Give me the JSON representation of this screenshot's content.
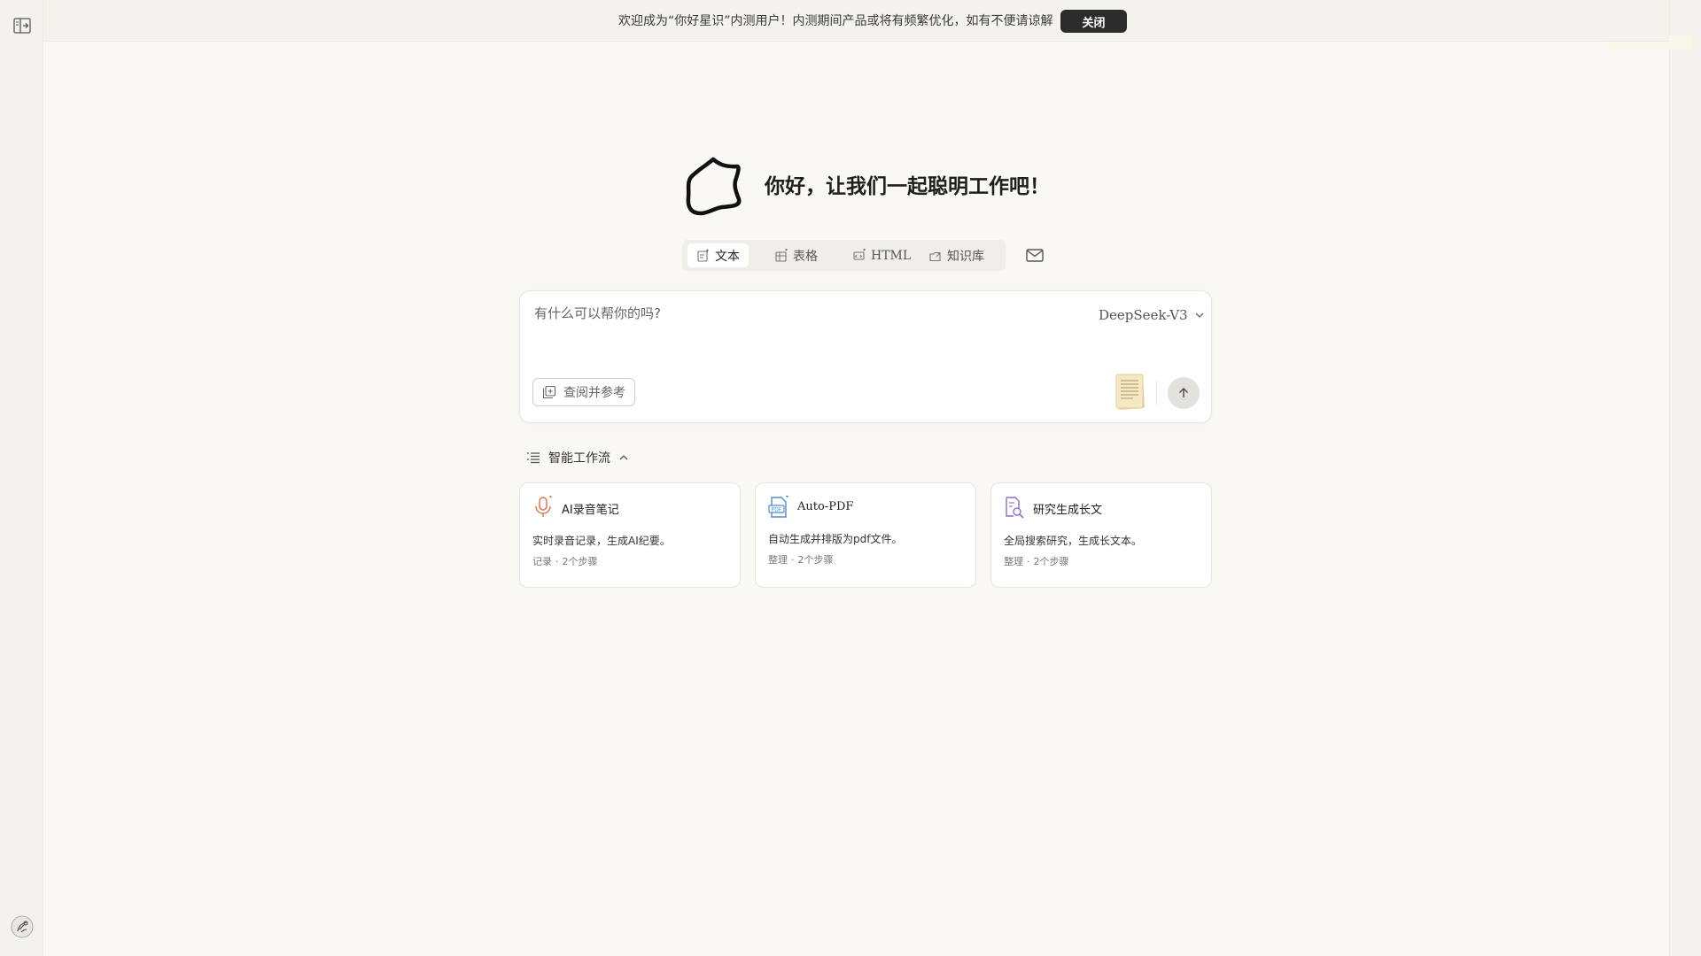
{
  "banner": {
    "message": "欢迎成为“你好星识”内测用户！内测期间产品或将有频繁优化，如有不便请谅解",
    "close_label": "关闭"
  },
  "hero": {
    "title": "你好，让我们一起聪明工作吧！"
  },
  "mode_tabs": [
    {
      "label": "文本",
      "icon": "text-edit-icon",
      "active": true
    },
    {
      "label": "表格",
      "icon": "table-icon",
      "active": false
    },
    {
      "label": "HTML",
      "icon": "html-icon",
      "active": false
    },
    {
      "label": "知识库",
      "icon": "knowledge-base-icon",
      "active": false
    }
  ],
  "input": {
    "placeholder": "有什么可以帮你的吗?",
    "value": "",
    "model": "DeepSeek-V3",
    "reference_label": "查阅并参考"
  },
  "workflows": {
    "header": "智能工作流",
    "items": [
      {
        "name": "AI录音笔记",
        "description": "实时录音记录，生成AI纪要。",
        "category": "记录",
        "steps": "2个步骤",
        "icon": "microphone-icon",
        "color": "#e0784f"
      },
      {
        "name": "Auto-PDF",
        "description": "自动生成并排版为pdf文件。",
        "category": "整理",
        "steps": "2个步骤",
        "icon": "pdf-file-icon",
        "color": "#4d8fd1"
      },
      {
        "name": "研究生成长文",
        "description": "全局搜索研究，生成长文本。",
        "category": "整理",
        "steps": "2个步骤",
        "icon": "document-search-icon",
        "color": "#8b6fd0"
      }
    ]
  },
  "colors": {
    "background": "#f9f8f4",
    "rail": "#f3f2ed",
    "accent_dark": "#2b2b2b"
  }
}
